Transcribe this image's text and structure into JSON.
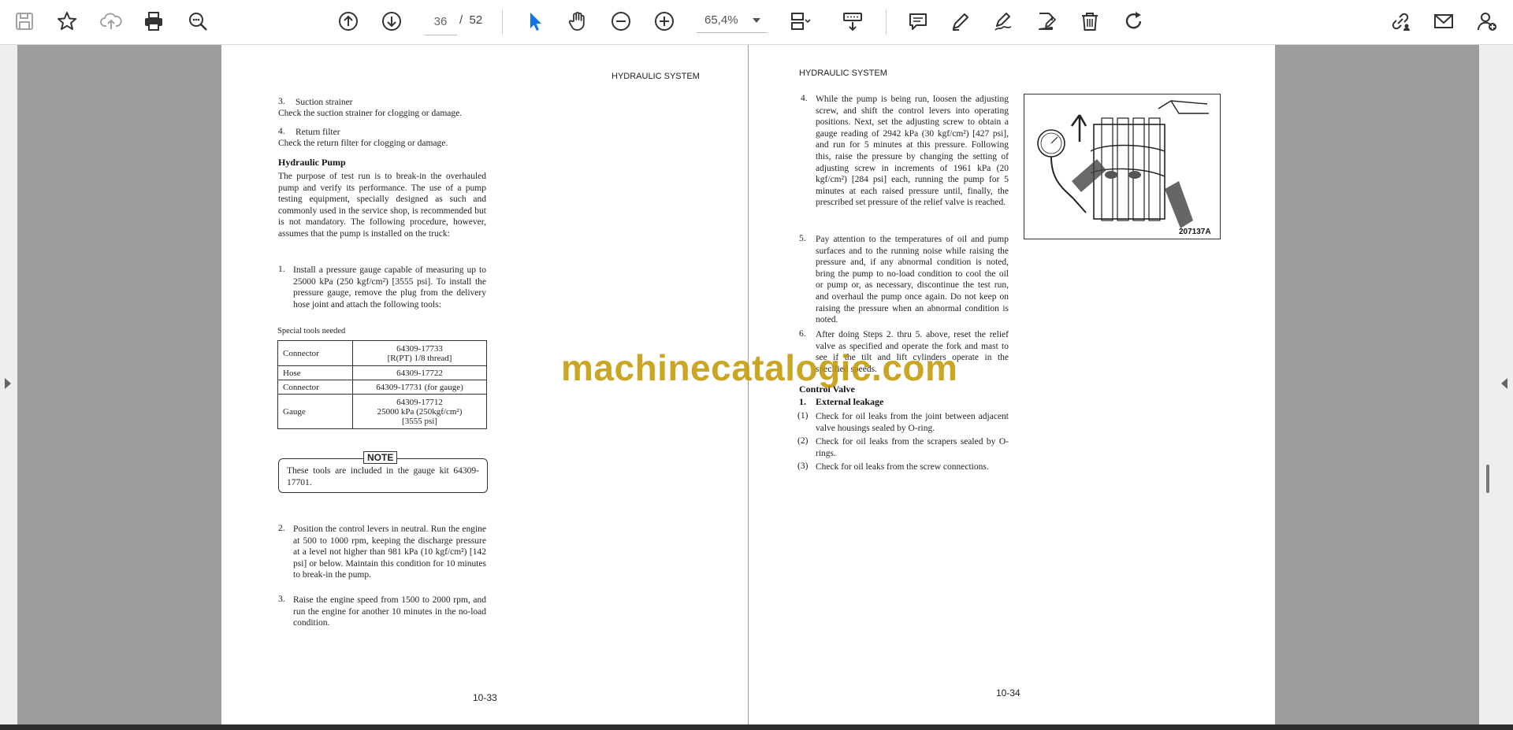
{
  "toolbar": {
    "current_page": "36",
    "page_separator": "/",
    "total_pages": "52",
    "zoom": "65,4%",
    "accent": "#1473e6"
  },
  "left_page": {
    "running_head": "HYDRAULIC SYSTEM",
    "item3_num": "3.",
    "item3_title": "Suction strainer",
    "item3_text": "Check the suction strainer for clogging or damage.",
    "item4_num": "4.",
    "item4_title": "Return filter",
    "item4_text": "Check the return filter for clogging or damage.",
    "pump_heading": "Hydraulic Pump",
    "pump_intro": "The purpose of test run is to break-in the overhauled pump and verify its performance. The use of a pump testing equipment, specially designed as such and commonly used in the service shop, is recommended but is not mandatory. The following procedure, however, assumes that the pump is installed on the truck:",
    "step1_num": "1.",
    "step1_text": "Install a pressure gauge capable of measuring up to 25000 kPa (250 kgf/cm²) [3555 psi]. To install the pressure gauge, remove the plug from the delivery hose joint and attach the following tools:",
    "tools_caption": "Special tools needed",
    "tools": [
      {
        "name": "Connector",
        "part": "64309-17733",
        "detail": "[R(PT) 1/8 thread]"
      },
      {
        "name": "Hose",
        "part": "64309-17722",
        "detail": ""
      },
      {
        "name": "Connector",
        "part": "64309-17731 (for gauge)",
        "detail": ""
      },
      {
        "name": "Gauge",
        "part": "64309-17712",
        "detail": "25000 kPa (250kgf/cm²)",
        "detail2": "[3555 psi]"
      }
    ],
    "note_label": "NOTE",
    "note_text": "These tools are included in the gauge kit 64309-17701.",
    "step2_num": "2.",
    "step2_text": "Position the control levers in neutral. Run the engine at 500 to 1000 rpm, keeping the discharge pressure at a level not higher than 981 kPa (10 kgf/cm²) [142 psi] or below. Maintain this condition for 10 minutes to break-in the pump.",
    "step3_num": "3.",
    "step3_text": "Raise the engine speed from 1500 to 2000 rpm, and run the engine for another 10 minutes in the no-load condition.",
    "folio": "10-33"
  },
  "right_page": {
    "running_head": "HYDRAULIC SYSTEM",
    "step4_num": "4.",
    "step4_text": "While the pump is being run, loosen the adjusting screw, and shift the control levers into operating positions. Next, set the adjusting screw to obtain a gauge reading of 2942 kPa (30 kgf/cm²) [427 psi], and run for 5 minutes at this pressure. Following this, raise the pressure by changing the setting of adjusting screw in increments of 1961 kPa (20 kgf/cm²) [284 psi] each, running the pump for 5 minutes at each raised pressure until, finally, the prescribed set pressure of the relief valve is reached.",
    "step5_num": "5.",
    "step5_text": "Pay attention to the temperatures of oil and pump surfaces and to the running noise while raising the pressure and, if any abnormal condition is noted, bring the pump to no-load condition to cool the oil or pump or, as necessary, discontinue the test run, and overhaul the pump once again. Do not keep on raising the pressure when an abnormal condition is noted.",
    "step6_num": "6.",
    "step6_text": "After doing Steps 2. thru 5. above, reset the relief valve as specified and operate the fork and mast to see if the tilt and lift cylinders operate in the specified speeds.",
    "cv_heading": "Control Valve",
    "cv_sub_num": "1.",
    "cv_sub": "External leakage",
    "cv1_num": "(1)",
    "cv1_text": "Check for oil leaks from the joint between adjacent valve housings sealed by O-ring.",
    "cv2_num": "(2)",
    "cv2_text": "Check for oil leaks from the scrapers sealed by O-rings.",
    "cv3_num": "(3)",
    "cv3_text": "Check for oil leaks from the screw connections.",
    "figure_label": "207137A",
    "folio": "10-34"
  },
  "watermark": "machinecatalogic.com"
}
